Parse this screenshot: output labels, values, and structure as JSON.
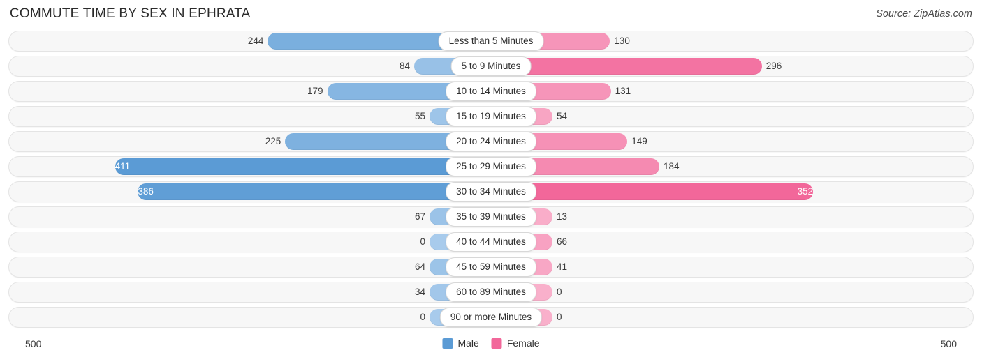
{
  "header": {
    "title": "COMMUTE TIME BY SEX IN EPHRATA",
    "source": "Source: ZipAtlas.com"
  },
  "footer": {
    "axis_min_label": "500",
    "axis_max_label": "500"
  },
  "legend": {
    "items": [
      {
        "label": "Male",
        "color": "#5b9bd5"
      },
      {
        "label": "Female",
        "color": "#f2679a"
      }
    ]
  },
  "chart_data": {
    "type": "bar",
    "orientation": "horizontal-diverging",
    "title": "COMMUTE TIME BY SEX IN EPHRATA",
    "xlabel": "",
    "ylabel": "",
    "axis_max": 500,
    "grid": true,
    "legend_position": "bottom-center",
    "categories": [
      "Less than 5 Minutes",
      "5 to 9 Minutes",
      "10 to 14 Minutes",
      "15 to 19 Minutes",
      "20 to 24 Minutes",
      "25 to 29 Minutes",
      "30 to 34 Minutes",
      "35 to 39 Minutes",
      "40 to 44 Minutes",
      "45 to 59 Minutes",
      "60 to 89 Minutes",
      "90 or more Minutes"
    ],
    "series": [
      {
        "name": "Male",
        "color": "#5b9bd5",
        "values": [
          244,
          84,
          179,
          55,
          225,
          411,
          386,
          67,
          0,
          64,
          34,
          0
        ]
      },
      {
        "name": "Female",
        "color": "#f2679a",
        "values": [
          130,
          296,
          131,
          54,
          149,
          184,
          352,
          13,
          66,
          41,
          0,
          0
        ]
      }
    ],
    "rows": [
      {
        "category": "Less than 5 Minutes",
        "male": 244,
        "male_label": "244",
        "female": 130,
        "female_label": "130"
      },
      {
        "category": "5 to 9 Minutes",
        "male": 84,
        "male_label": "84",
        "female": 296,
        "female_label": "296"
      },
      {
        "category": "10 to 14 Minutes",
        "male": 179,
        "male_label": "179",
        "female": 131,
        "female_label": "131"
      },
      {
        "category": "15 to 19 Minutes",
        "male": 55,
        "male_label": "55",
        "female": 54,
        "female_label": "54"
      },
      {
        "category": "20 to 24 Minutes",
        "male": 225,
        "male_label": "225",
        "female": 149,
        "female_label": "149"
      },
      {
        "category": "25 to 29 Minutes",
        "male": 411,
        "male_label": "411",
        "female": 184,
        "female_label": "184"
      },
      {
        "category": "30 to 34 Minutes",
        "male": 386,
        "male_label": "386",
        "female": 352,
        "female_label": "352"
      },
      {
        "category": "35 to 39 Minutes",
        "male": 67,
        "male_label": "67",
        "female": 13,
        "female_label": "13"
      },
      {
        "category": "40 to 44 Minutes",
        "male": 0,
        "male_label": "0",
        "female": 66,
        "female_label": "66"
      },
      {
        "category": "45 to 59 Minutes",
        "male": 64,
        "male_label": "64",
        "female": 41,
        "female_label": "41"
      },
      {
        "category": "60 to 89 Minutes",
        "male": 34,
        "male_label": "34",
        "female": 0,
        "female_label": "0"
      },
      {
        "category": "90 or more Minutes",
        "male": 0,
        "male_label": "0",
        "female": 0,
        "female_label": "0"
      }
    ]
  }
}
